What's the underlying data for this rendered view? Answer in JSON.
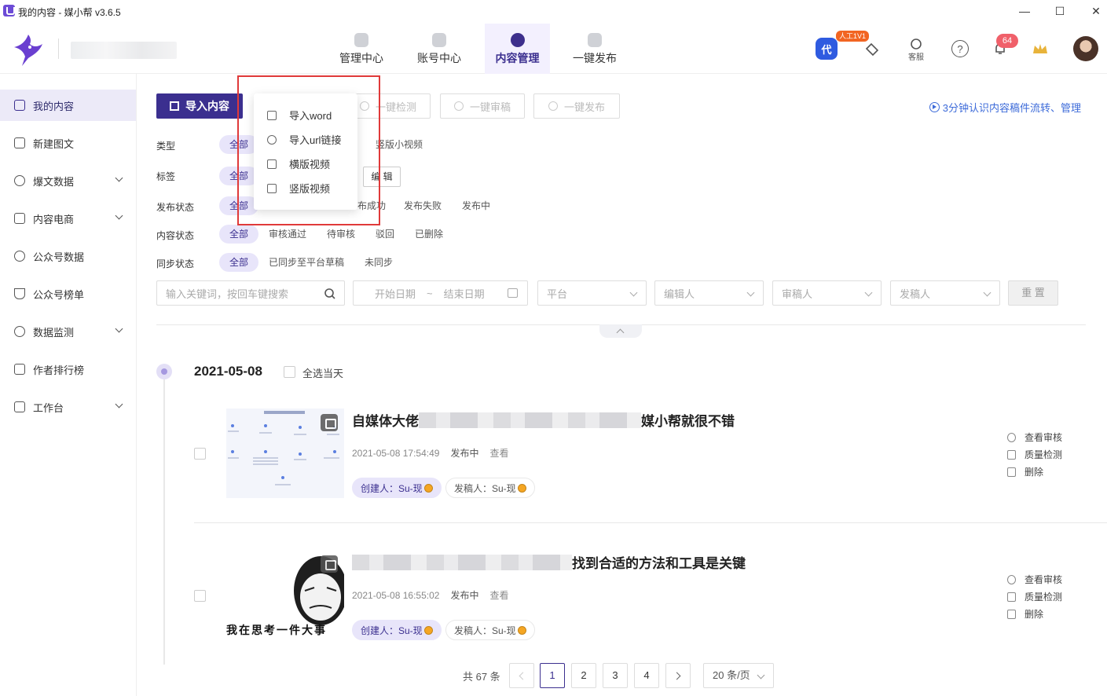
{
  "window": {
    "title": "我的内容 - 媒小帮 v3.6.5",
    "min": "—",
    "max": "☐",
    "close": "✕"
  },
  "topnav": [
    {
      "label": "管理中心",
      "icon": "briefcase-icon"
    },
    {
      "label": "账号中心",
      "icon": "user-icon"
    },
    {
      "label": "内容管理",
      "icon": "content-icon"
    },
    {
      "label": "一键发布",
      "icon": "publish-icon"
    }
  ],
  "header_right": {
    "vip_badge": "人工1V1",
    "service_label": "客服",
    "notification_count": "64"
  },
  "sidebar": [
    {
      "label": "我的内容"
    },
    {
      "label": "新建图文"
    },
    {
      "label": "爆文数据"
    },
    {
      "label": "内容电商"
    },
    {
      "label": "公众号数据"
    },
    {
      "label": "公众号榜单"
    },
    {
      "label": "数据监测"
    },
    {
      "label": "作者排行榜"
    },
    {
      "label": "工作台"
    }
  ],
  "toolbar": {
    "import_label": "导入内容",
    "check_label": "一键检测",
    "review_label": "一键审稿",
    "publish_label": "一键发布",
    "help_link": "3分钟认识内容稿件流转、管理"
  },
  "import_menu": [
    "导入word",
    "导入url链接",
    "横版视频",
    "竖版视频"
  ],
  "filters": {
    "type": {
      "label": "类型",
      "all": "全部",
      "extra": "竖版小视频"
    },
    "tag": {
      "label": "标签",
      "all": "全部",
      "edit": "编 辑"
    },
    "publish_status": {
      "label": "发布状态",
      "all": "全部",
      "partial": "布成功",
      "failed": "发布失败",
      "publishing": "发布中"
    },
    "content_status": {
      "label": "内容状态",
      "options": [
        "全部",
        "审核通过",
        "待审核",
        "驳回",
        "已删除"
      ]
    },
    "sync_status": {
      "label": "同步状态",
      "options": [
        "全部",
        "已同步至平台草稿",
        "未同步"
      ]
    }
  },
  "search": {
    "keyword_placeholder": "输入关键词，按回车键搜索",
    "start_date": "开始日期",
    "date_sep": "~",
    "end_date": "结束日期",
    "platform": "平台",
    "editor": "编辑人",
    "reviewer": "审稿人",
    "publisher": "发稿人",
    "reset": "重 置"
  },
  "timeline": {
    "date": "2021-05-08",
    "select_all": "全选当天"
  },
  "articles": [
    {
      "title_start": "自媒体大佬",
      "title_end": "媒小帮就很不错",
      "time": "2021-05-08 17:54:49",
      "status": "发布中",
      "view": "查看",
      "creator": "创建人：Su-现",
      "publisher": "发稿人：Su-现",
      "actions": [
        "查看审核",
        "质量检测",
        "删除"
      ]
    },
    {
      "title_start": "",
      "title_end": "找到合适的方法和工具是关键",
      "time": "2021-05-08 16:55:02",
      "status": "发布中",
      "view": "查看",
      "creator": "创建人：Su-现",
      "publisher": "发稿人：Su-现",
      "actions": [
        "查看审核",
        "质量检测",
        "删除"
      ],
      "thumb_caption": "我在思考一件大事"
    }
  ],
  "pagination": {
    "total": "共 67 条",
    "pages": [
      "1",
      "2",
      "3",
      "4"
    ],
    "page_size": "20 条/页"
  },
  "colors": {
    "primary": "#3b2f8f",
    "link": "#3d6bd9",
    "highlight_box": "#e03a3a"
  }
}
